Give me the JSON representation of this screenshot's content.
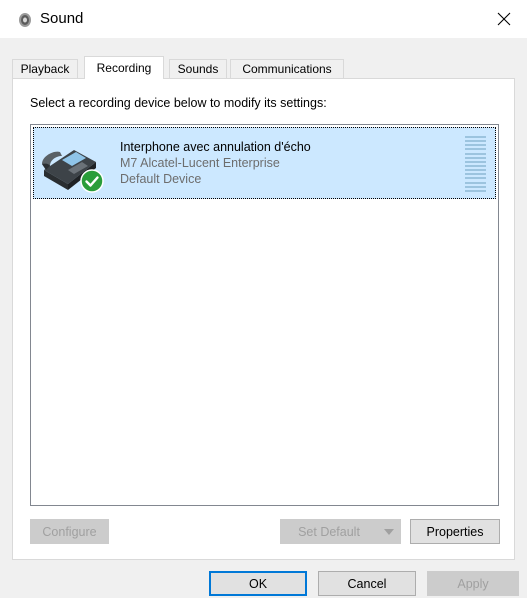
{
  "window": {
    "title": "Sound",
    "icons": {
      "app": "speaker-icon",
      "close": "close-icon"
    }
  },
  "tabs": [
    {
      "label": "Playback",
      "active": false
    },
    {
      "label": "Recording",
      "active": true
    },
    {
      "label": "Sounds",
      "active": false
    },
    {
      "label": "Communications",
      "active": false
    }
  ],
  "recording": {
    "instruction": "Select a recording device below to modify its settings:",
    "devices": [
      {
        "name": "Interphone avec annulation d'écho",
        "driver": "M7 Alcatel-Lucent Enterprise",
        "status": "Default Device",
        "icon": "desk-phone-icon",
        "badge": "default-check-icon",
        "selected": true
      }
    ],
    "buttons": {
      "configure": "Configure",
      "set_default": "Set Default",
      "properties": "Properties"
    }
  },
  "dialog_buttons": {
    "ok": "OK",
    "cancel": "Cancel",
    "apply": "Apply"
  },
  "colors": {
    "selection": "#cce8ff",
    "focus_blue": "#0078d7",
    "check_green": "#2a9d3a"
  }
}
